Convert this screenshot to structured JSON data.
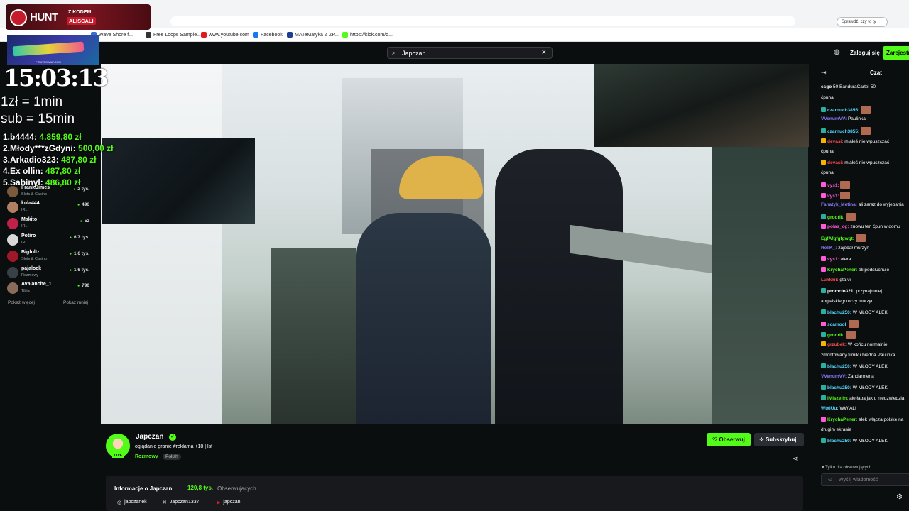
{
  "browser": {
    "search_placeholder": "Sprawdź, czy to ty",
    "bookmarks": [
      {
        "label": "Wave Shore f...",
        "color": "#3a6bd8"
      },
      {
        "label": "Free Loops Sample...",
        "color": "#333333"
      },
      {
        "label": "www.youtube.com",
        "color": "#e01b1b"
      },
      {
        "label": "Facebook",
        "color": "#1877f2"
      },
      {
        "label": "MATeMatyka Z ZP...",
        "color": "#1d3f8f"
      },
      {
        "label": "https://kick.com/d...",
        "color": "#53fc18"
      }
    ]
  },
  "topbar": {
    "search_value": "Japczan",
    "login_label": "Zaloguj się",
    "register_label": "Zarejestruj"
  },
  "overlay": {
    "hunt": {
      "brand": "HUNT",
      "code_prefix": "Z KODEM",
      "code": "ALISCALI"
    },
    "skin_caption": "PIRATESWAP.COM",
    "timer": "15:03:13",
    "rule1": "1zł = 1min",
    "rule2": "sub = 15min",
    "donors": [
      {
        "rank": "1.",
        "name": "b4444:",
        "amount": "4.859,80 zł"
      },
      {
        "rank": "2.",
        "name": "Młody***zGdyni:",
        "amount": "500,00 zł"
      },
      {
        "rank": "3.",
        "name": "Arkadio323:",
        "amount": "487,80 zł"
      },
      {
        "rank": "4.",
        "name": "Ex ollin:",
        "amount": "487,80 zł"
      },
      {
        "rank": "5.",
        "name": "Sabinyl:",
        "amount": "486,80 zł"
      }
    ]
  },
  "sidebar": {
    "items": [
      {
        "name": "FrankDimes",
        "category": "Slots & Casino",
        "viewers": "2 tys.",
        "color": "#7a5a3a"
      },
      {
        "name": "kula444",
        "category": "IRL",
        "viewers": "496",
        "color": "#b08060"
      },
      {
        "name": "Makito",
        "category": "IRL",
        "viewers": "52",
        "color": "#c0204a"
      },
      {
        "name": "Potiro",
        "category": "IRL",
        "viewers": "6,7 tys.",
        "color": "#d8d8d8"
      },
      {
        "name": "Bigfoltz",
        "category": "Slots & Casino",
        "viewers": "1,6 tys.",
        "color": "#a01828"
      },
      {
        "name": "pajalock",
        "category": "Rozmowy",
        "viewers": "1,6 tys.",
        "color": "#3a4048"
      },
      {
        "name": "Avalanche_1",
        "category": "Tibia",
        "viewers": "790",
        "color": "#8a6a58"
      }
    ],
    "show_more": "Pokaż więcej",
    "show_less": "Pokaż mniej"
  },
  "channel": {
    "name": "Japczan",
    "live_badge": "LIVE",
    "title": "oglądanie granie #reklama +18 | lsf",
    "category": "Rozmowy",
    "tag": "Polish",
    "follow_label": "Obserwuj",
    "subscribe_label": "Subskrybuj",
    "about_title": "Informacje o Japczan",
    "followers": "120,8 tys.",
    "followers_label": "Obserwujących",
    "socials": [
      {
        "icon": "instagram-icon",
        "glyph": "◎",
        "handle": "japczanek"
      },
      {
        "icon": "x-icon",
        "glyph": "𝕏",
        "handle": "Japczan1337"
      },
      {
        "icon": "youtube-icon",
        "glyph": "▶",
        "handle": "japczan"
      }
    ]
  },
  "chat": {
    "title": "Czat",
    "followers_only": "Tylko dla obserwujących",
    "input_placeholder": "Wyślij wiadomość",
    "messages": [
      {
        "user": "csgo",
        "user_color": "#ffffff",
        "text": "50  BanduraCartel 50",
        "badge": ""
      },
      {
        "user": "",
        "user_color": "#ffffff",
        "text": "ćpuna",
        "badge": ""
      },
      {
        "user": "czarnuch3855:",
        "user_color": "#53d8ff",
        "text": "",
        "badge": "#2bb0a0",
        "emote": true
      },
      {
        "user": "VVenumVV:",
        "user_color": "#8a7cff",
        "text": "Paulinka",
        "badge": ""
      },
      {
        "user": "czarnuch3855:",
        "user_color": "#53d8ff",
        "text": "",
        "badge": "#2bb0a0",
        "emote": true
      },
      {
        "user": "devasi:",
        "user_color": "#ff4d4d",
        "text": "miałeś nie wpuszczać",
        "badge": "#f5b400"
      },
      {
        "user": "",
        "user_color": "#ffffff",
        "text": "ćpuna",
        "badge": ""
      },
      {
        "user": "devasi:",
        "user_color": "#ff4d4d",
        "text": "miałeś nie wpuszczać",
        "badge": "#f5b400"
      },
      {
        "user": "",
        "user_color": "#ffffff",
        "text": "ćpuna",
        "badge": ""
      },
      {
        "user": "vys1:",
        "user_color": "#ff5ad8",
        "text": "",
        "badge": "#ff5ad8",
        "emote": true
      },
      {
        "user": "vys1:",
        "user_color": "#ff5ad8",
        "text": "",
        "badge": "#ff5ad8",
        "emote": true
      },
      {
        "user": "Fanatyk_Metina:",
        "user_color": "#8a7cff",
        "text": "ali zaraz do wyjebania",
        "badge": ""
      },
      {
        "user": "grodrik:",
        "user_color": "#53fc18",
        "text": "",
        "badge": "#2bb0a0",
        "emote": true
      },
      {
        "user": "polas_og:",
        "user_color": "#ff5ad8",
        "text": "znowu ten ćpun w domu",
        "badge": "#ff5ad8"
      },
      {
        "user": "EgfAfgfgfgwgt:",
        "user_color": "#53fc18",
        "text": "",
        "badge": "",
        "emote": true
      },
      {
        "user": "ReliK_:",
        "user_color": "#8a7cff",
        "text": "zajebał murzyn",
        "badge": ""
      },
      {
        "user": "vys1:",
        "user_color": "#ff5ad8",
        "text": "afera",
        "badge": "#ff5ad8"
      },
      {
        "user": "KrychaPener:",
        "user_color": "#53fc18",
        "text": "ali podsłuchuje",
        "badge": "#ff5ad8"
      },
      {
        "user": "Lukkkii:",
        "user_color": "#ff4d4d",
        "text": "gta vi",
        "badge": ""
      },
      {
        "user": "promcio321:",
        "user_color": "#ffffff",
        "text": "przynajmniej",
        "badge": "#2bb0a0"
      },
      {
        "user": "",
        "user_color": "#ffffff",
        "text": "angielskiego uczy murzyn",
        "badge": ""
      },
      {
        "user": "blachu250:",
        "user_color": "#53d8ff",
        "text": "W  MŁODY ALEK",
        "badge": "#2bb0a0"
      },
      {
        "user": "scamool:",
        "user_color": "#53d8ff",
        "text": "",
        "badge": "#ff5ad8",
        "emote": true
      },
      {
        "user": "grodrik:",
        "user_color": "#53fc18",
        "text": "",
        "badge": "#2bb0a0",
        "emote": true
      },
      {
        "user": "grzubek:",
        "user_color": "#ff4d4d",
        "text": "W końcu normalnie",
        "badge": "#f5b400"
      },
      {
        "user": "",
        "user_color": "#ffffff",
        "text": "zmontowany filmik i biedna Paulinka",
        "badge": ""
      },
      {
        "user": "blachu250:",
        "user_color": "#53d8ff",
        "text": "W  MŁODY ALEK",
        "badge": "#2bb0a0"
      },
      {
        "user": "VVenumVV:",
        "user_color": "#8a7cff",
        "text": "Żandarmeria",
        "badge": ""
      },
      {
        "user": "blachu250:",
        "user_color": "#53d8ff",
        "text": "W  MŁODY ALEK",
        "badge": "#2bb0a0"
      },
      {
        "user": "iMiszelin:",
        "user_color": "#53fc18",
        "text": "ale łapa jak u niedźwiedzia",
        "badge": "#2bb0a0"
      },
      {
        "user": "WtxiUu:",
        "user_color": "#53d8ff",
        "text": "WW ALI",
        "badge": ""
      },
      {
        "user": "KrychaPener:",
        "user_color": "#53fc18",
        "text": "alek włącza polskę na",
        "badge": "#ff5ad8"
      },
      {
        "user": "",
        "user_color": "#ffffff",
        "text": "drugim ekranie",
        "badge": ""
      },
      {
        "user": "blachu250:",
        "user_color": "#53d8ff",
        "text": "W  MŁODY ALEK",
        "badge": "#2bb0a0"
      }
    ]
  },
  "colors": {
    "accent": "#53fc18",
    "bg": "#0b0e0f",
    "panel": "#17191c"
  }
}
